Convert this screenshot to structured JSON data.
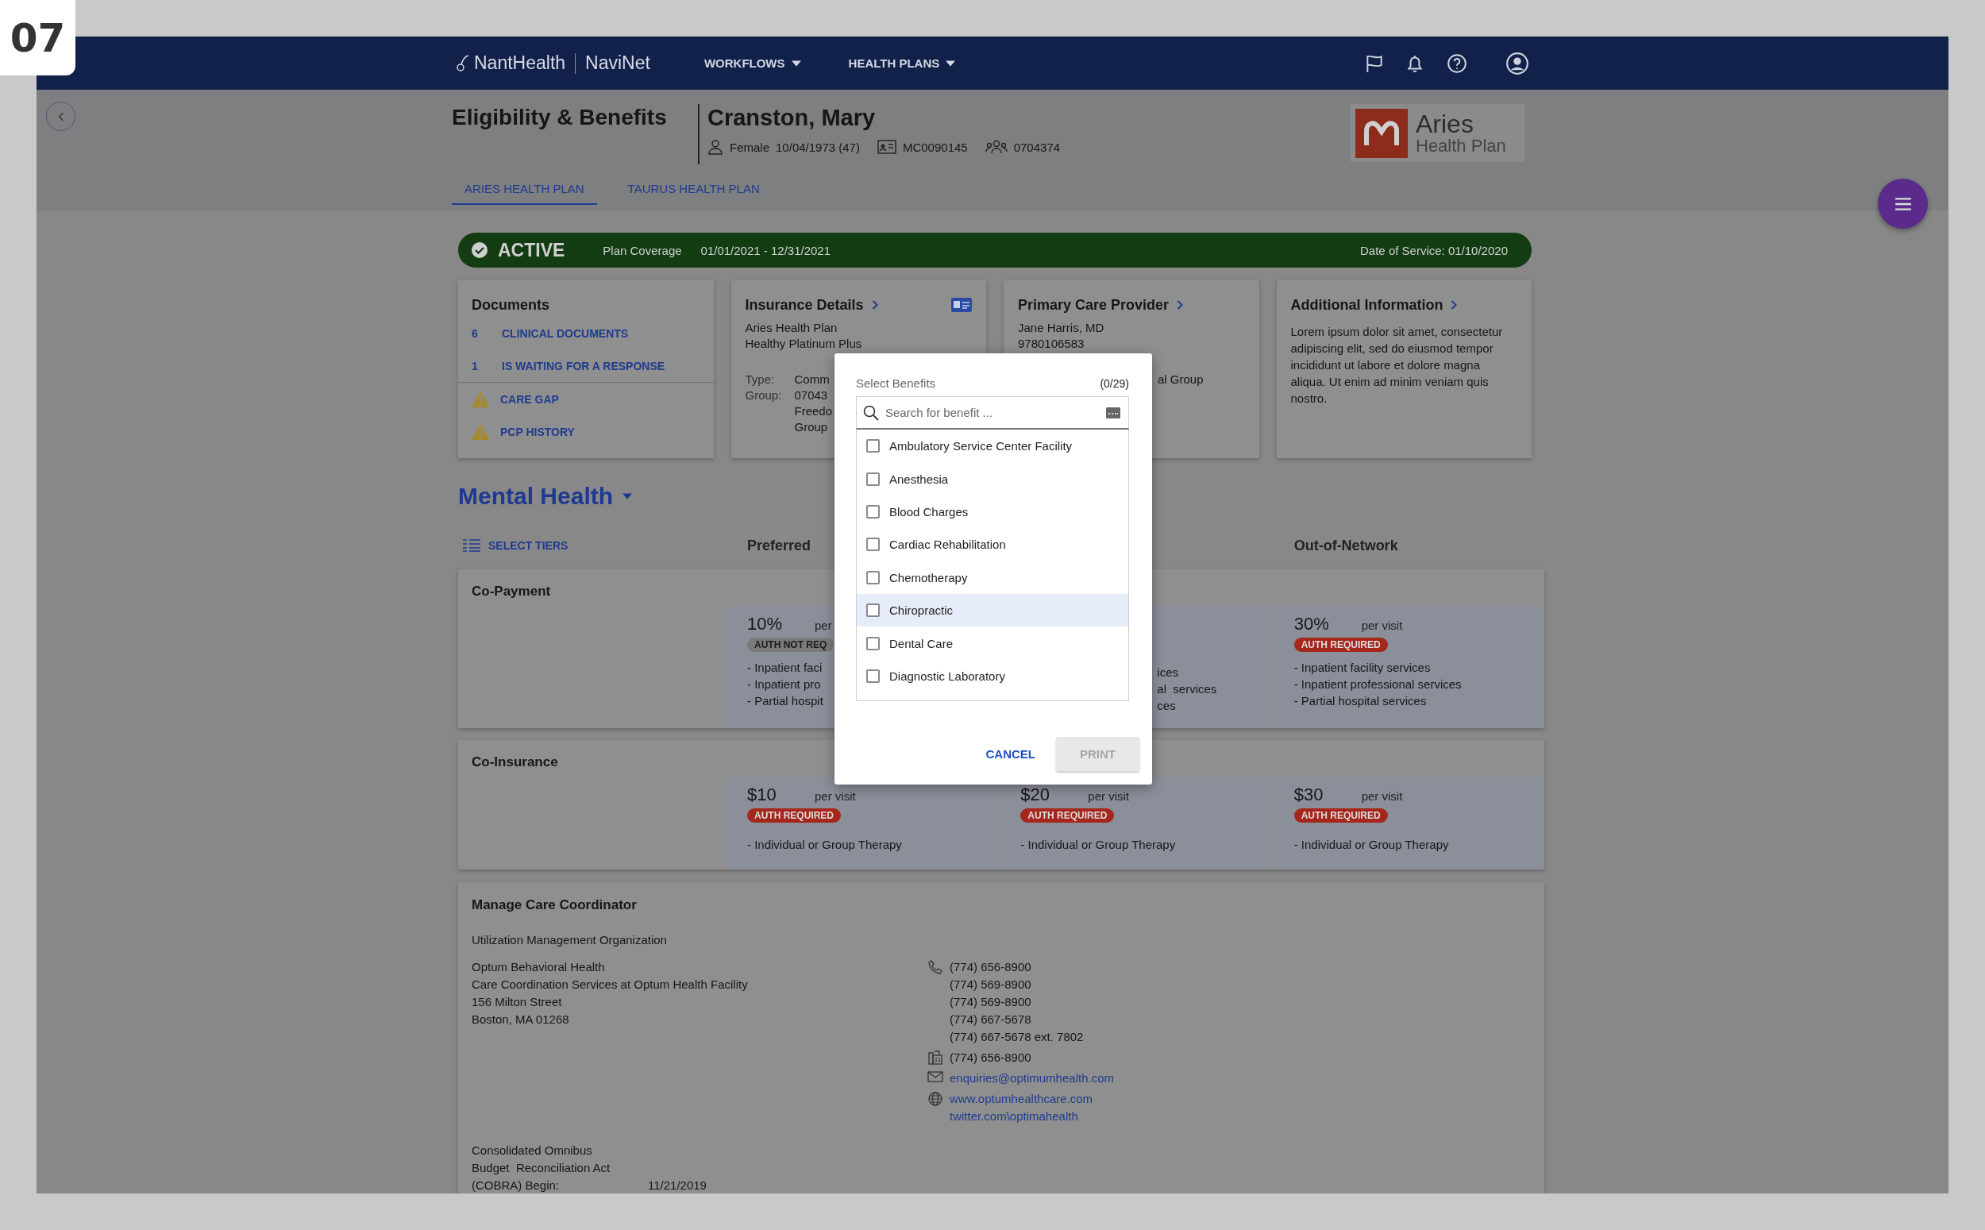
{
  "badge": "07",
  "nav": {
    "brand": "NantHealth",
    "product": "NaviNet",
    "menus": [
      {
        "label": "WORKFLOWS"
      },
      {
        "label": "HEALTH PLANS"
      }
    ]
  },
  "header": {
    "title": "Eligibility & Benefits",
    "patient": {
      "name": "Cranston, Mary",
      "gender": "Female",
      "dob": "10/04/1973 (47)",
      "member_id": "MC0090145",
      "group_id": "0704374"
    },
    "plan_logo": {
      "name": "Aries",
      "subtitle": "Health Plan"
    }
  },
  "tabs": [
    {
      "label": "ARIES HEALTH PLAN",
      "selected": true
    },
    {
      "label": "TAURUS HEALTH PLAN",
      "selected": false
    }
  ],
  "status": {
    "label": "ACTIVE",
    "coverage_label": "Plan Coverage",
    "coverage": "01/01/2021 - 12/31/2021",
    "date_of_service": "Date of Service: 01/10/2020"
  },
  "documents": {
    "title": "Documents",
    "items": [
      {
        "kind": "count",
        "count": "6",
        "label": "CLINICAL DOCUMENTS"
      },
      {
        "kind": "count",
        "count": "1",
        "label": "IS WAITING FOR A RESPONSE"
      },
      {
        "kind": "warning",
        "label": "CARE GAP"
      },
      {
        "kind": "warning",
        "label": "PCP HISTORY"
      }
    ]
  },
  "insurance": {
    "title": "Insurance Details",
    "lines": [
      "Aries Health Plan",
      "Healthy Platinum Plus"
    ],
    "fields": [
      {
        "label": "Type:",
        "values": [
          "Comm"
        ]
      },
      {
        "label": "Group:",
        "values": [
          "07043",
          "Freedo",
          "Group"
        ]
      }
    ]
  },
  "pcp": {
    "title": "Primary Care Provider",
    "lines": [
      "Jane Harris, MD",
      "9780106583"
    ],
    "fragment": "al Group"
  },
  "additional": {
    "title": "Additional Information",
    "text": "Lorem ipsum dolor sit amet, consectetur adipiscing elit, sed do eiusmod tempor incididunt ut labore et dolore magna aliqua. Ut enim ad minim veniam quis nostro."
  },
  "section": {
    "title": "Mental Health",
    "select_tiers": "SELECT TIERS",
    "tier_columns": [
      {
        "hidden": false,
        "header": "Preferred"
      },
      {
        "hidden": true
      },
      {
        "hidden": false,
        "header": "Out-of-Network"
      }
    ]
  },
  "benefits": [
    {
      "label": "Co-Payment",
      "cells": [
        {
          "kind": "full",
          "amount": "10%",
          "unit": "per",
          "badge": {
            "text": "AUTH NOT REQ",
            "kind": "neutral"
          },
          "services": [
            "- Inpatient faci",
            "- Inpatient pro",
            "- Partial hospit"
          ]
        },
        {
          "kind": "fragment",
          "services": [
            "ices",
            "al  services",
            "ces"
          ]
        },
        {
          "kind": "full",
          "amount": "30%",
          "unit": "per visit",
          "badge": {
            "text": "AUTH REQUIRED",
            "kind": "required"
          },
          "services": [
            "- Inpatient facility services",
            "- Inpatient professional services",
            "- Partial hospital services"
          ]
        }
      ]
    },
    {
      "label": "Co-Insurance",
      "cells": [
        {
          "kind": "full",
          "amount": "$10",
          "unit": "per visit",
          "badge": {
            "text": "AUTH REQUIRED",
            "kind": "required"
          },
          "services": [
            "- Individual or Group Therapy"
          ]
        },
        {
          "kind": "full",
          "amount": "$20",
          "unit": "per visit",
          "badge": {
            "text": "AUTH REQUIRED",
            "kind": "required"
          },
          "services": [
            "- Individual or Group Therapy"
          ]
        },
        {
          "kind": "full",
          "amount": "$30",
          "unit": "per visit",
          "badge": {
            "text": "AUTH REQUIRED",
            "kind": "required"
          },
          "services": [
            "- Individual or Group Therapy"
          ]
        }
      ]
    }
  ],
  "care_coordinator": {
    "title": "Manage Care Coordinator",
    "org_label": "Utilization Management Organization",
    "address": [
      "Optum Behavioral Health",
      "Care Coordination Services at Optum Health Facility",
      "156 Milton Street",
      "Boston, MA 01268"
    ],
    "contacts": [
      {
        "kind": "phone",
        "link": false,
        "lines": [
          "(774) 656-8900",
          "(774) 569-8900",
          "(774) 569-8900",
          "(774) 667-5678",
          "(774) 667-5678 ext. 7802"
        ]
      },
      {
        "kind": "fax",
        "link": false,
        "lines": [
          "(774) 656-8900"
        ]
      },
      {
        "kind": "email",
        "link": true,
        "lines": [
          "enquiries@optimumhealth.com"
        ]
      },
      {
        "kind": "web",
        "link": true,
        "lines": [
          "www.optumhealthcare.com",
          "twitter.com\\optimahealth"
        ]
      }
    ],
    "cobra": {
      "label_lines": [
        "Consolidated Omnibus",
        "Budget  Reconciliation Act",
        "(COBRA) Begin:"
      ],
      "date": "11/21/2019"
    }
  },
  "modal": {
    "title": "Select Benefits",
    "count": "(0/29)",
    "search": {
      "placeholder": "Search for benefit ..."
    },
    "items": [
      {
        "label": "Ambulatory Service Center Facility",
        "checked": false,
        "hovered": false
      },
      {
        "label": "Anesthesia",
        "checked": false,
        "hovered": false
      },
      {
        "label": "Blood Charges",
        "checked": false,
        "hovered": false
      },
      {
        "label": "Cardiac Rehabilitation",
        "checked": false,
        "hovered": false
      },
      {
        "label": "Chemotherapy",
        "checked": false,
        "hovered": false
      },
      {
        "label": "Chiropractic",
        "checked": false,
        "hovered": true
      },
      {
        "label": "Dental Care",
        "checked": false,
        "hovered": false
      },
      {
        "label": "Diagnostic Laboratory",
        "checked": false,
        "hovered": false
      }
    ],
    "buttons": [
      {
        "label": "CANCEL",
        "kind": "text",
        "disabled": false
      },
      {
        "label": "PRINT",
        "kind": "raised",
        "disabled": true
      }
    ]
  }
}
